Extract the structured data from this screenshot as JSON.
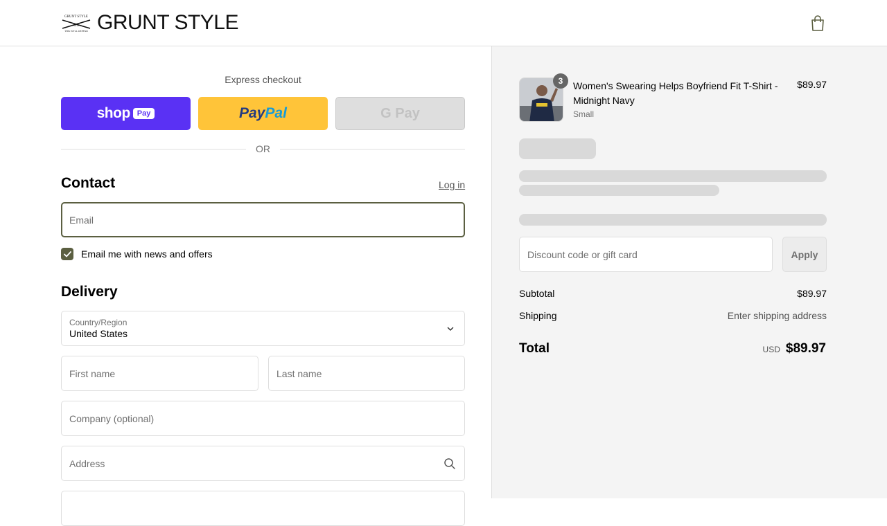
{
  "header": {
    "brand": "GRUNT STYLE",
    "cart_icon": "shopping-bag-icon"
  },
  "express": {
    "title": "Express checkout",
    "shop_label": "shop",
    "shop_pay_tag": "Pay",
    "paypal_pay": "Pay",
    "paypal_pal": "Pal",
    "gpay_label": "G Pay",
    "or_label": "OR"
  },
  "contact": {
    "title": "Contact",
    "login_label": "Log in",
    "email_placeholder": "Email",
    "newsletter_label": "Email me with news and offers",
    "newsletter_checked": true
  },
  "delivery": {
    "title": "Delivery",
    "country_label": "Country/Region",
    "country_value": "United States",
    "first_name_placeholder": "First name",
    "last_name_placeholder": "Last name",
    "company_placeholder": "Company (optional)",
    "address_placeholder": "Address"
  },
  "summary": {
    "product": {
      "title": "Women's Swearing Helps Boyfriend Fit T-Shirt - Midnight Navy",
      "variant": "Small",
      "price": "$89.97",
      "quantity": "3"
    },
    "discount_placeholder": "Discount code or gift card",
    "apply_label": "Apply",
    "subtotal_label": "Subtotal",
    "subtotal_value": "$89.97",
    "shipping_label": "Shipping",
    "shipping_value": "Enter shipping address",
    "total_label": "Total",
    "currency": "USD",
    "total_value": "$89.97"
  },
  "colors": {
    "accent": "#5b5f41",
    "shop_pay": "#5a31f4",
    "paypal": "#ffc439",
    "summary_bg": "#f4f4f4"
  }
}
